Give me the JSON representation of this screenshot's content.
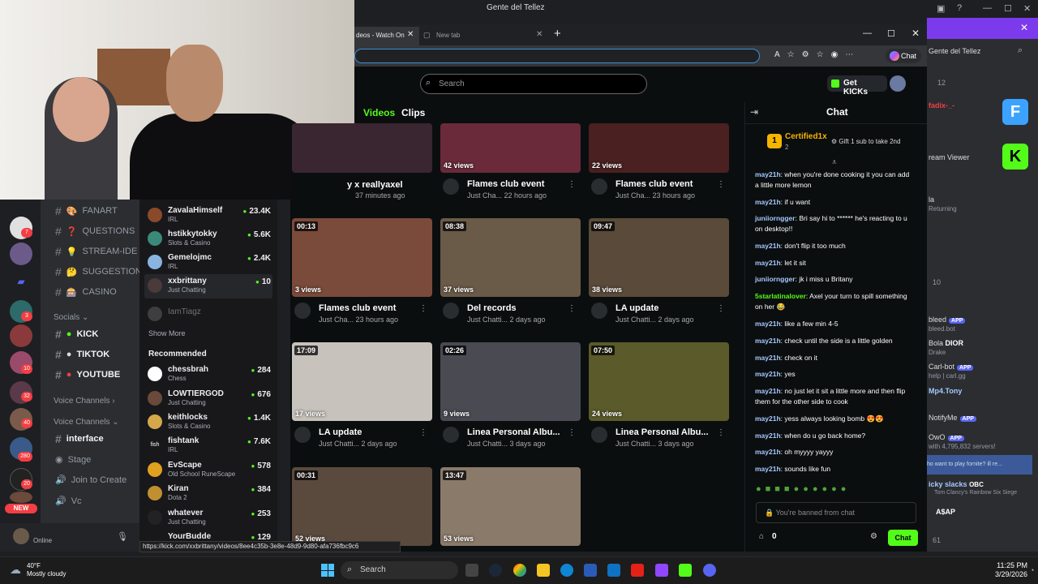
{
  "window": {
    "title": "Gente del Tellez"
  },
  "discord_channels": {
    "text": [
      {
        "name": "FANART",
        "emoji": "🎨"
      },
      {
        "name": "QUESTIONS",
        "emoji": "❓"
      },
      {
        "name": "STREAM-IDE",
        "emoji": "💡"
      },
      {
        "name": "SUGGESTION",
        "emoji": "🤔"
      },
      {
        "name": "CASINO",
        "emoji": "🎰"
      }
    ],
    "socials_label": "Socials",
    "socials": [
      "KICK",
      "TIKTOK",
      "YOUTUBE"
    ],
    "voice_label_1": "Voice Channels",
    "voice_label_2": "Voice Channels",
    "voice_items": [
      "interface",
      "Stage",
      "Join to Create",
      "Vc"
    ],
    "user_status": "Online",
    "new_badge": "NEW",
    "server_badges": [
      "7",
      "3",
      "10",
      "32",
      "40",
      "280",
      "20"
    ]
  },
  "kick_sidebar": {
    "following": [
      {
        "name": "ZavalaHimself",
        "sub": "IRL",
        "count": "23.4K"
      },
      {
        "name": "hstikkytokky",
        "sub": "Slots & Casino",
        "count": "5.6K"
      },
      {
        "name": "Gemelojmc",
        "sub": "IRL",
        "count": "2.4K"
      },
      {
        "name": "xxbrittany",
        "sub": "Just Chatting",
        "count": "10"
      },
      {
        "name": "IamTiagz",
        "sub": "",
        "count": ""
      }
    ],
    "show_more": "Show More",
    "recommended_label": "Recommended",
    "recommended": [
      {
        "name": "chessbrah",
        "sub": "Chess",
        "count": "284"
      },
      {
        "name": "LOWTIERGOD",
        "sub": "Just Chatting",
        "count": "676"
      },
      {
        "name": "keithlocks",
        "sub": "Slots & Casino",
        "count": "1.4K"
      },
      {
        "name": "fishtank",
        "sub": "IRL",
        "count": "7.6K"
      },
      {
        "name": "EvScape",
        "sub": "Old School RuneScape",
        "count": "578"
      },
      {
        "name": "Kiran",
        "sub": "Dota 2",
        "count": "384"
      },
      {
        "name": "whatever",
        "sub": "Just Chatting",
        "count": "253"
      },
      {
        "name": "YourBudde",
        "sub": "",
        "count": "129"
      }
    ]
  },
  "browser": {
    "tab1": "deos - Watch On",
    "tab2": "New tab",
    "chat_btn": "Chat",
    "search_placeholder": "Search",
    "get_kicks": "Get KICKs",
    "tab_videos": "Videos",
    "tab_clips": "Clips"
  },
  "videos": [
    {
      "title": "y x reallyaxel",
      "meta": "37 minutes ago",
      "views": "",
      "duration": "",
      "color": "#3a2630"
    },
    {
      "title": "Flames club event",
      "meta": "Just Cha... 22 hours ago",
      "views": "42 views",
      "duration": "",
      "color": "#6a2a3a"
    },
    {
      "title": "Flames club event",
      "meta": "Just Cha... 23 hours ago",
      "views": "22 views",
      "duration": "",
      "color": "#4a2020"
    },
    {
      "title": "Flames club event",
      "meta": "Just Cha... 23 hours ago",
      "views": "3 views",
      "duration": "00:13",
      "color": "#7a4a3a"
    },
    {
      "title": "Del records",
      "meta": "Just Chatti... 2 days ago",
      "views": "37 views",
      "duration": "08:38",
      "color": "#6a5a48"
    },
    {
      "title": "LA update",
      "meta": "Just Chatti... 2 days ago",
      "views": "38 views",
      "duration": "09:47",
      "color": "#5a4a3a"
    },
    {
      "title": "LA update",
      "meta": "Just Chatti... 2 days ago",
      "views": "17 views",
      "duration": "17:09",
      "color": "#c8c2bc"
    },
    {
      "title": "Linea Personal Albu...",
      "meta": "Just Chatti... 3 days ago",
      "views": "9 views",
      "duration": "02:26",
      "color": "#4a4a52"
    },
    {
      "title": "Linea Personal Albu...",
      "meta": "Just Chatti... 3 days ago",
      "views": "24 views",
      "duration": "07:50",
      "color": "#5a5a2a"
    },
    {
      "title": "",
      "meta": "",
      "views": "52 views",
      "duration": "00:31",
      "color": "#5a4a3e"
    },
    {
      "title": "",
      "meta": "",
      "views": "53 views",
      "duration": "13:47",
      "color": "#8a7a6a"
    }
  ],
  "chat": {
    "title": "Chat",
    "pinned_user": "Certified1x",
    "pinned_num": "2",
    "gift_text": "Gift 1 sub to take 2nd",
    "messages": [
      {
        "user": "may21h",
        "text": "when you're done cooking it you can add a little more lemon"
      },
      {
        "user": "may21h",
        "text": "if u want"
      },
      {
        "user": "juniiorngger",
        "text": "Bri say hi to ****** he's reacting to u on desktop!!"
      },
      {
        "user": "may21h",
        "text": "don't flip it too much"
      },
      {
        "user": "may21h",
        "text": "let it sit"
      },
      {
        "user": "juniiorngger",
        "text": "jk i miss u Britany"
      },
      {
        "user": "5starlatinalover",
        "text": "Axel your turn to spill something on her 😂"
      },
      {
        "user": "may21h",
        "text": "like a few min 4-5"
      },
      {
        "user": "may21h",
        "text": "check until the side is a little golden"
      },
      {
        "user": "may21h",
        "text": "check on it"
      },
      {
        "user": "may21h",
        "text": "yes"
      },
      {
        "user": "may21h",
        "text": "no just let it sit a little more and then flip them for the other side to cook"
      },
      {
        "user": "may21h",
        "text": "yess always looking bomb 😍😍"
      },
      {
        "user": "may21h",
        "text": "when do u go back home?"
      },
      {
        "user": "may21h",
        "text": "oh myyyy yayyy"
      },
      {
        "user": "may21h",
        "text": "sounds like fun"
      }
    ],
    "banned_text": "You're banned from chat",
    "points": "0",
    "send_label": "Chat"
  },
  "right_pane": {
    "title": "Gente del Tellez",
    "count": "12",
    "lines": [
      "fadix-_-",
      "ream Viewer",
      "la",
      "Returning",
      "10",
      "bleed",
      "bleed.bot",
      "Bola",
      "DIOR",
      "Drake",
      "Carl-bot",
      "help | carl.gg",
      "Mp4.Tony",
      "NotifyMe",
      "OwO",
      "with 4,795,832 servers!",
      "ho want to play fornite? ill re...",
      "icky slacks",
      "OBC",
      "Tom Clancy's Rainbow Six Siege",
      "A$AP",
      "61"
    ],
    "app_tag": "APP"
  },
  "status_url": "https://kick.com/xxbrittany/videos/8ee4c35b-3e8e-48d9-9d80-afa736fbc9c6",
  "taskbar": {
    "weather_temp": "40°F",
    "weather_desc": "Mostly cloudy",
    "search": "Search",
    "time": "11:25 PM",
    "date": "3/29/2026"
  }
}
